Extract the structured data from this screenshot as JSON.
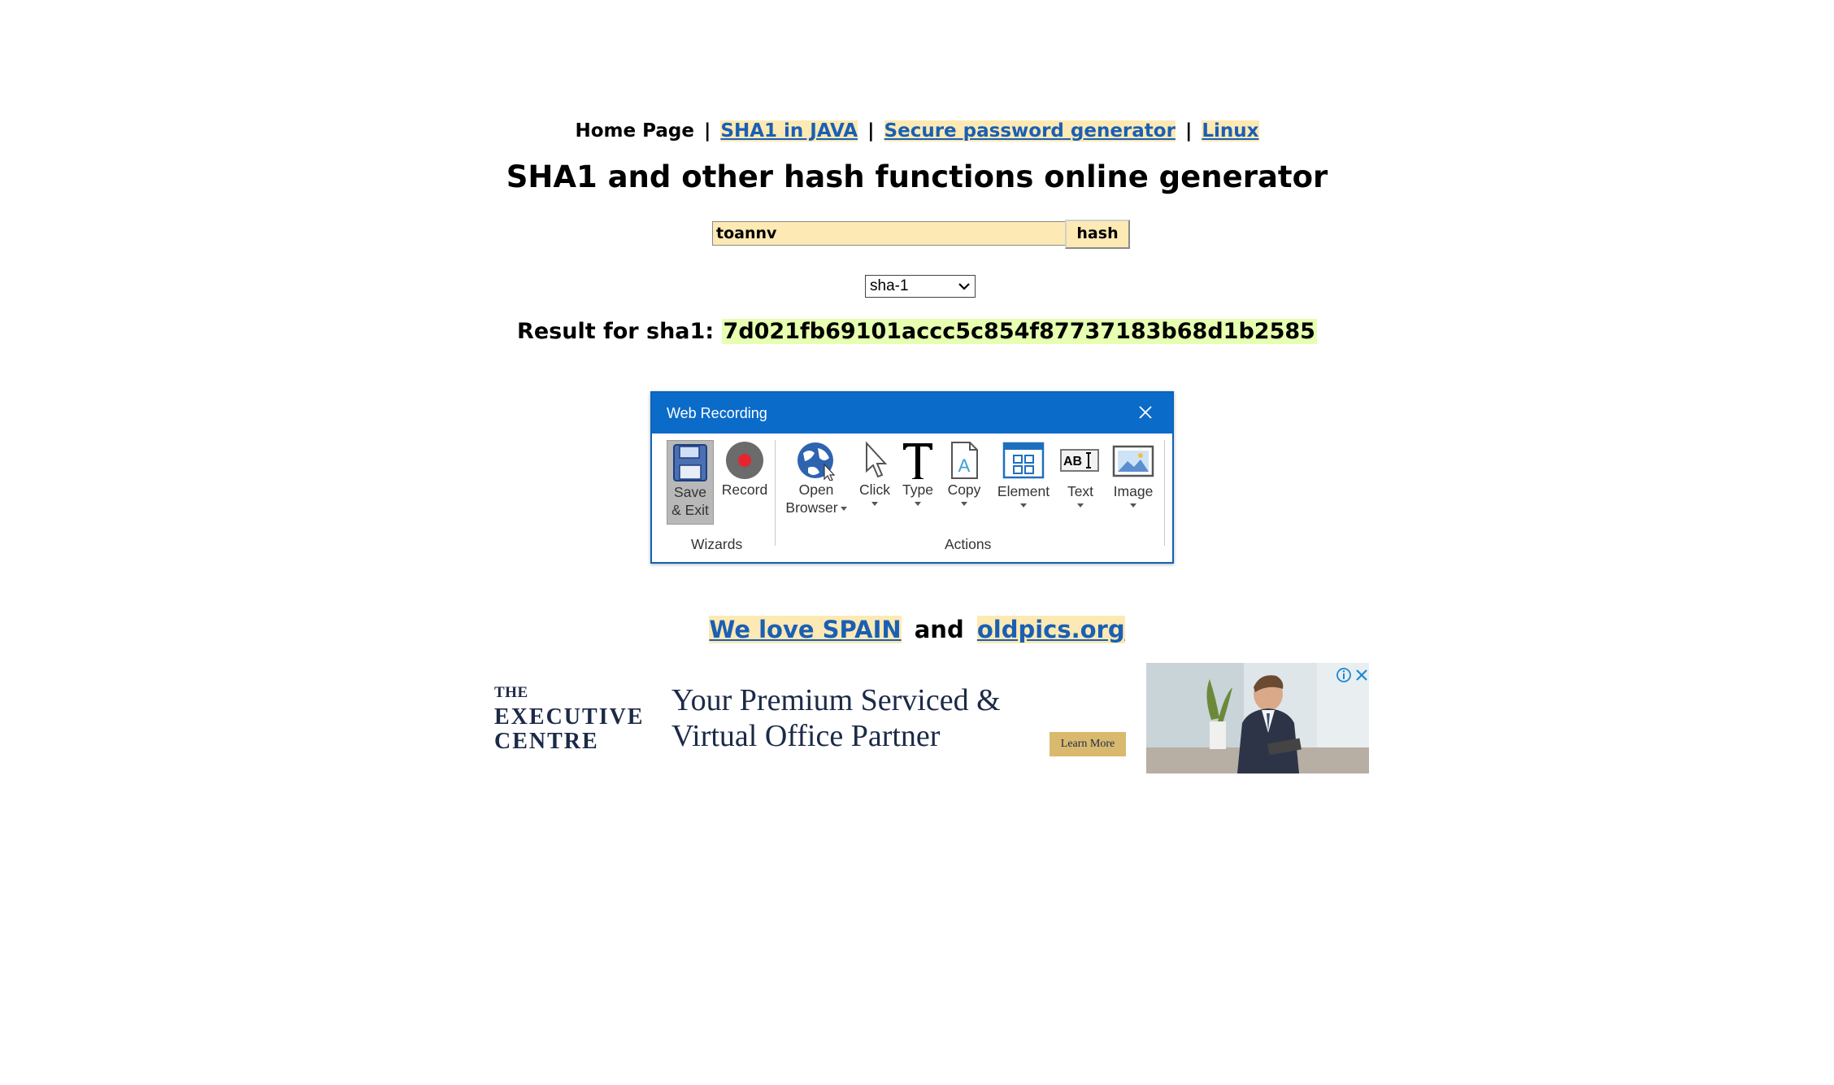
{
  "nav": {
    "home": "Home Page",
    "sep": "|",
    "link1": "SHA1 in JAVA",
    "link2": "Secure password generator",
    "link3": "Linux"
  },
  "title": "SHA1 and other hash functions online generator",
  "form": {
    "input_value": "toannv",
    "button_label": "hash",
    "algorithm_selected": "sha-1"
  },
  "result": {
    "label": "Result for sha1:",
    "value": "7d021fb69101accc5c854f87737183b68d1b2585"
  },
  "dialog": {
    "title": "Web Recording",
    "tools": {
      "save": {
        "line1": "Save",
        "line2": "& Exit"
      },
      "record": "Record",
      "open": {
        "line1": "Open",
        "line2": "Browser"
      },
      "click": "Click",
      "type": "Type",
      "copy": "Copy",
      "element": "Element",
      "text": "Text",
      "image": "Image"
    },
    "groups": {
      "wizards": "Wizards",
      "actions": "Actions"
    }
  },
  "links2": {
    "link1": "We love SPAIN",
    "and": "and",
    "link2": "oldpics.org"
  },
  "ad": {
    "logo_line1": "THE",
    "logo_line2": "EXECUTIVE",
    "logo_line3": "CENTRE",
    "headline1": "Your Premium Serviced &",
    "headline2": "Virtual Office Partner",
    "cta": "Learn More"
  },
  "colors": {
    "highlight": "#fde9b4",
    "result_highlight": "#e6ffb0",
    "link": "#1a5fb4",
    "dialog_header": "#0b6bc9"
  },
  "icons": [
    "close-icon",
    "save-icon",
    "record-icon",
    "globe-icon",
    "cursor-icon",
    "type-icon",
    "copy-icon",
    "element-icon",
    "text-icon",
    "image-icon",
    "chevron-down-icon",
    "info-icon"
  ]
}
